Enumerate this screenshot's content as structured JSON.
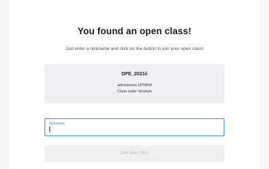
{
  "header": {
    "title": "You found an open class!",
    "subtitle": "Just enter a nickname and click on the button to join your open class!"
  },
  "class_info": {
    "name": "DPE_2021ii",
    "organization": "admisiones UPNFM",
    "code_text": "Class code: fecekek"
  },
  "form": {
    "nickname_label": "Nickname",
    "nickname_value": "",
    "join_button_label": "Join open class",
    "join_button_state": "disabled"
  },
  "colors": {
    "accent": "#4a90d9",
    "background": "#f7f7f7",
    "panel": "#f0f0f2"
  }
}
